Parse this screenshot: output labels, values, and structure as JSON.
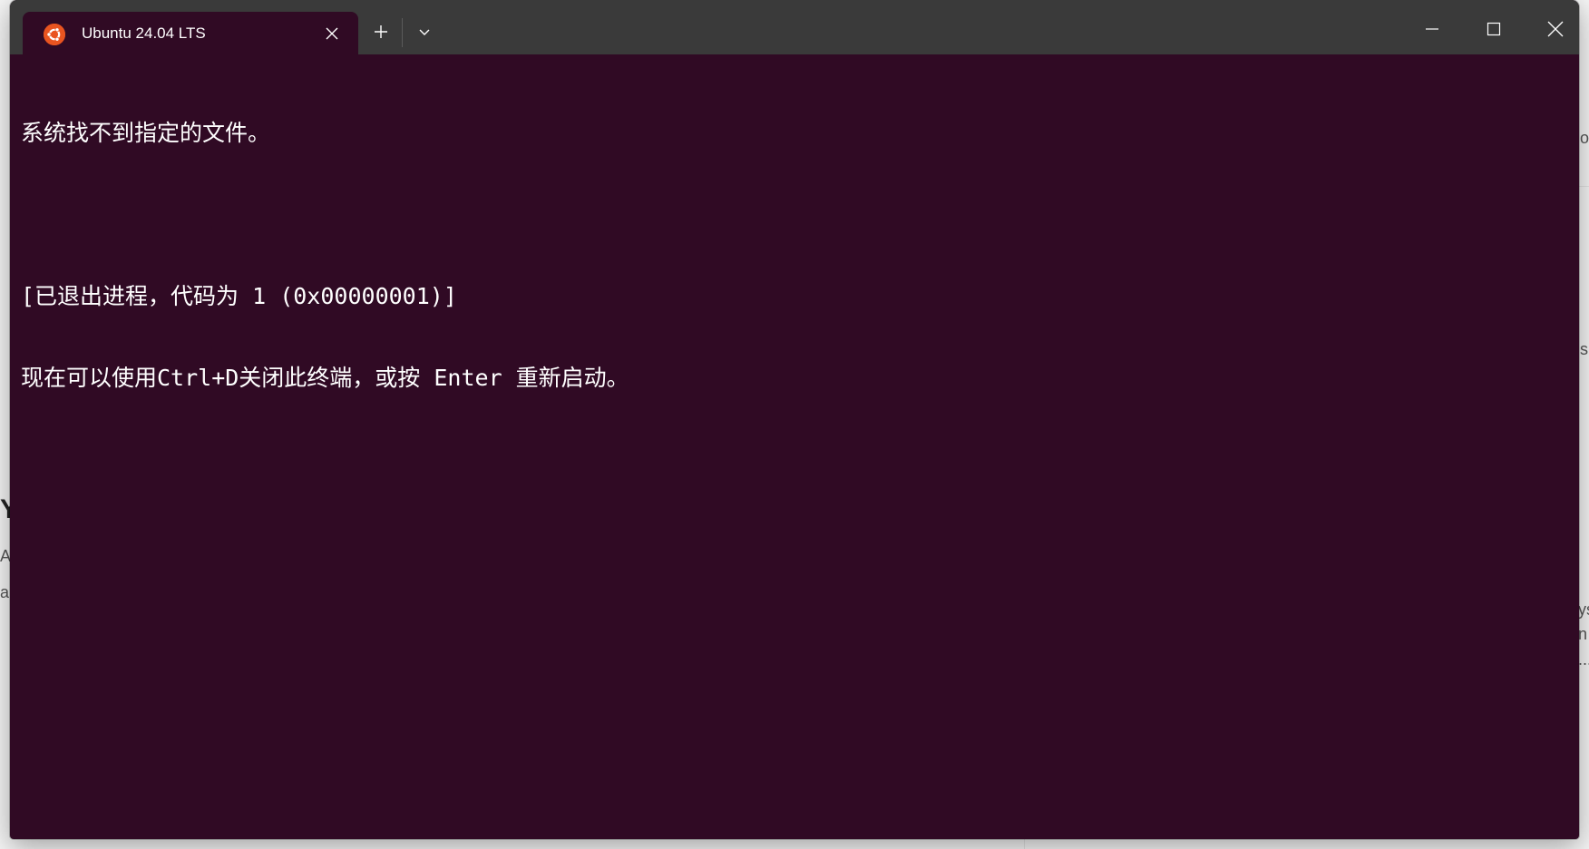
{
  "window": {
    "tab_title": "Ubuntu 24.04 LTS",
    "tab_icon": "ubuntu-logo-icon",
    "accent": "#e95420",
    "terminal_bg": "#300a24",
    "titlebar_bg": "#3a3a3a"
  },
  "terminal": {
    "lines": [
      "系统找不到指定的文件。",
      "",
      "[已退出进程，代码为 1 (0x00000001)]",
      "现在可以使用Ctrl+D关闭此终端，或按 Enter 重新启动。"
    ]
  },
  "background": {
    "fragments": [
      "o.",
      "s",
      "Y",
      "A",
      "a",
      "ys",
      "n",
      "..."
    ]
  }
}
